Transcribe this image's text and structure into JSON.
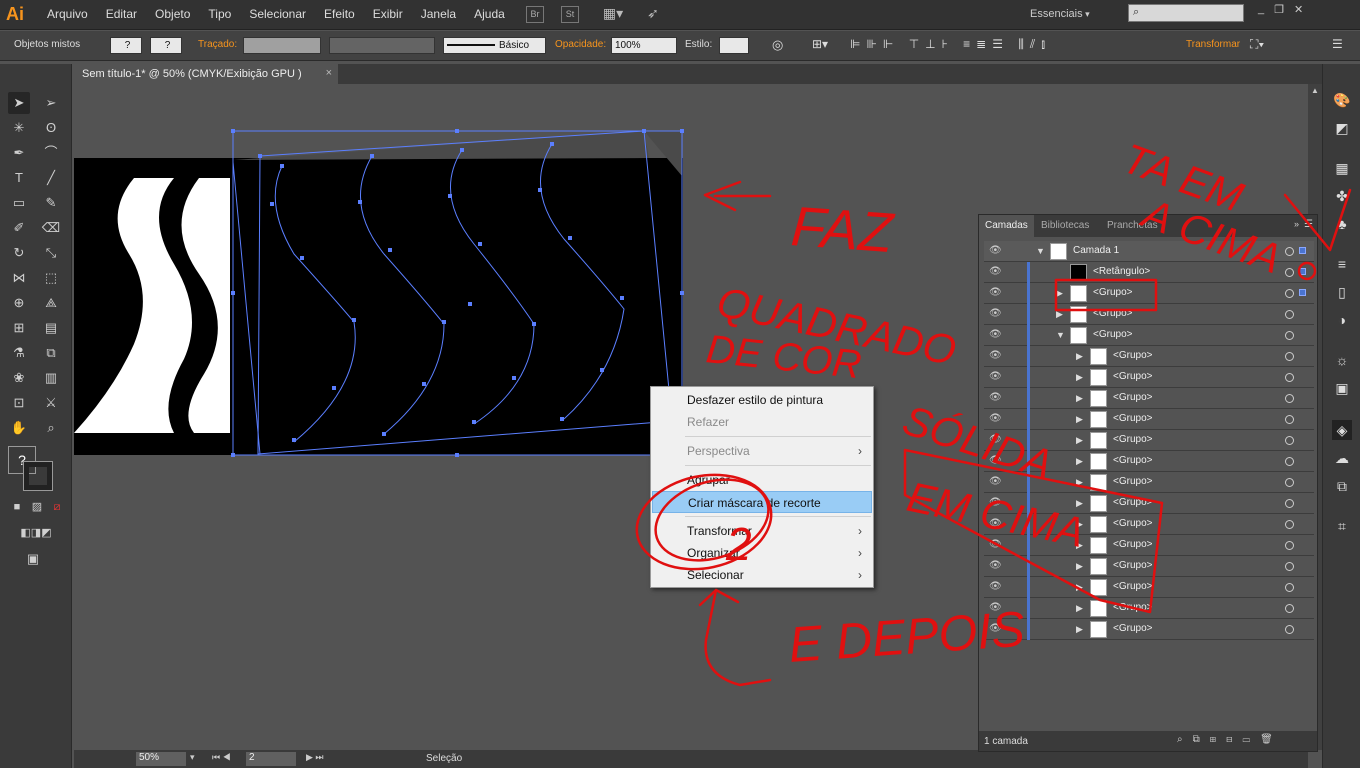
{
  "app": {
    "logo": "Ai"
  },
  "menubar": {
    "items": [
      "Arquivo",
      "Editar",
      "Objeto",
      "Tipo",
      "Selecionar",
      "Efeito",
      "Exibir",
      "Janela",
      "Ajuda"
    ],
    "bridge": "Br",
    "stock": "St",
    "workspace": "Essenciais",
    "window_controls": [
      "_",
      "❐",
      "✕"
    ]
  },
  "control_bar": {
    "selection_label": "Objetos mistos",
    "stroke_label": "Traçado:",
    "brush_label": "Básico",
    "opacity_label": "Opacidade:",
    "opacity_value": "100%",
    "style_label": "Estilo:",
    "transform_label": "Transformar",
    "question": "?"
  },
  "document_tab": {
    "title": "Sem título-1* @ 50% (CMYK/Exibição GPU )",
    "close": "×"
  },
  "context_menu": {
    "items": [
      {
        "label": "Desfazer estilo de pintura",
        "disabled": false,
        "submenu": false
      },
      {
        "label": "Refazer",
        "disabled": true,
        "submenu": false
      },
      {
        "label": "Perspectiva",
        "disabled": true,
        "submenu": true
      },
      {
        "label": "Agrupar",
        "disabled": false,
        "submenu": false
      },
      {
        "label": "Criar máscara de recorte",
        "disabled": false,
        "submenu": false,
        "highlighted": true
      },
      {
        "label": "Transformar",
        "disabled": false,
        "submenu": true
      },
      {
        "label": "Organizar",
        "disabled": false,
        "submenu": true
      },
      {
        "label": "Selecionar",
        "disabled": false,
        "submenu": true
      }
    ]
  },
  "layers_panel": {
    "tabs": [
      "Camadas",
      "Bibliotecas",
      "Pranchetas"
    ],
    "rows": [
      {
        "name": "Camada 1",
        "level": 0,
        "expanded": true
      },
      {
        "name": "<Retângulo>",
        "level": 1,
        "expanded": null
      },
      {
        "name": "<Grupo>",
        "level": 1,
        "expanded": false
      },
      {
        "name": "<Grupo>",
        "level": 1,
        "expanded": false
      },
      {
        "name": "<Grupo>",
        "level": 1,
        "expanded": true
      },
      {
        "name": "<Grupo>",
        "level": 2,
        "expanded": false
      },
      {
        "name": "<Grupo>",
        "level": 2,
        "expanded": false
      },
      {
        "name": "<Grupo>",
        "level": 2,
        "expanded": false
      },
      {
        "name": "<Grupo>",
        "level": 2,
        "expanded": false
      },
      {
        "name": "<Grupo>",
        "level": 2,
        "expanded": false
      },
      {
        "name": "<Grupo>",
        "level": 2,
        "expanded": false
      },
      {
        "name": "<Grupo>",
        "level": 2,
        "expanded": false
      },
      {
        "name": "<Grupo>",
        "level": 2,
        "expanded": false
      },
      {
        "name": "<Grupo>",
        "level": 2,
        "expanded": false
      },
      {
        "name": "<Grupo>",
        "level": 2,
        "expanded": false
      },
      {
        "name": "<Grupo>",
        "level": 2,
        "expanded": false
      },
      {
        "name": "<Grupo>",
        "level": 2,
        "expanded": false
      },
      {
        "name": "<Grupo>",
        "level": 2,
        "expanded": false
      },
      {
        "name": "<Grupo>",
        "level": 2,
        "expanded": false
      }
    ],
    "footer": "1 camada"
  },
  "status_bar": {
    "zoom": "50%",
    "artboard": "2",
    "tool": "Seleção"
  },
  "annotations": [
    "FAZ",
    "QUADRADO",
    "DE COR",
    "SÓLIDA",
    "EM CIMA",
    "E DEPOIS",
    "TA EM",
    "A CIMA",
    "2"
  ],
  "colors": {
    "accent": "#f7941d",
    "selection": "#4a74d0",
    "annotation": "#e01010"
  }
}
